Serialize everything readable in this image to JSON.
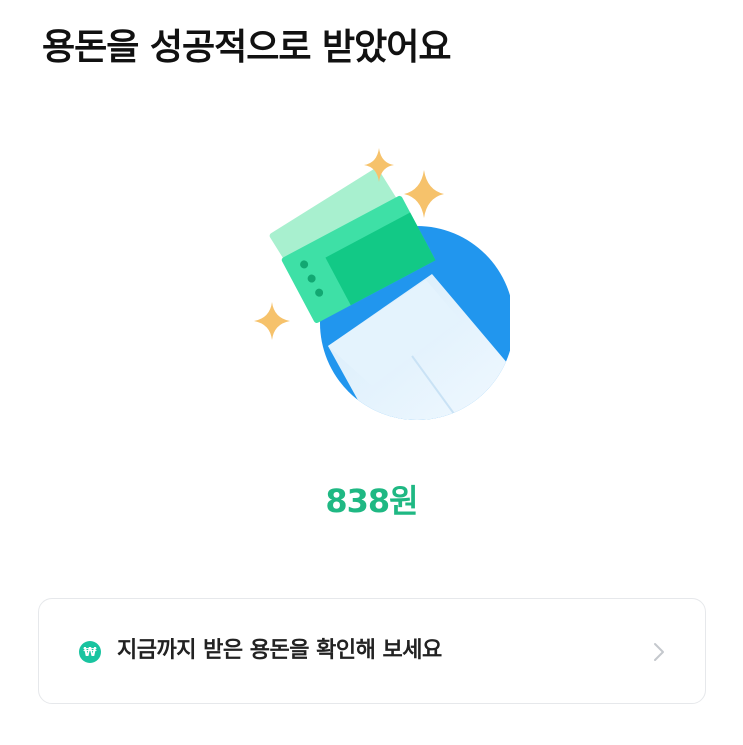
{
  "header": {
    "title": "용돈을 성공적으로 받았어요"
  },
  "illustration": {
    "name": "money-envelope-illustration",
    "colors": {
      "circle": "#2196ee",
      "envelope": "#e4f3fd",
      "bill": "#3ee0a6",
      "bill_dark": "#12c986",
      "sparkle": "#f6c26b"
    }
  },
  "reward": {
    "amount_text": "838원",
    "color": "#1fb883"
  },
  "check_allowance": {
    "icon": "won-circle-icon",
    "icon_glyph": "₩",
    "icon_color": "#19c4a0",
    "label": "지금까지 받은 용돈을 확인해 보세요",
    "chevron": "chevron-right-icon"
  }
}
